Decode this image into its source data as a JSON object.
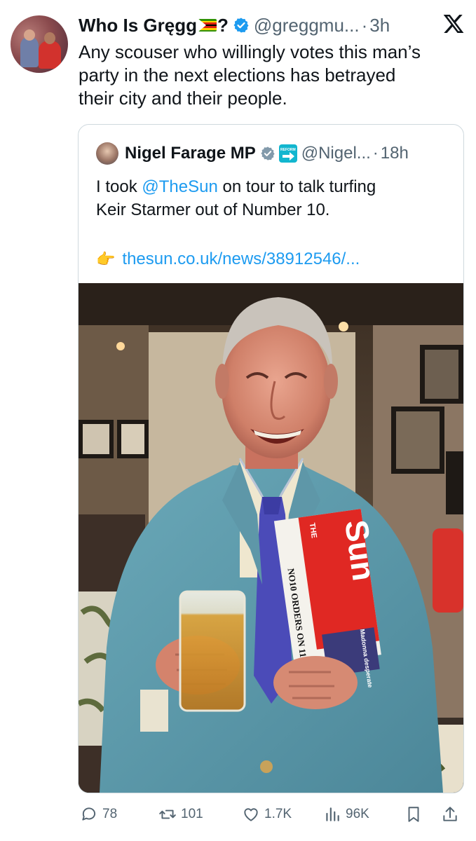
{
  "tweet": {
    "author_name": "Who Is Gręgg",
    "author_name_suffix": "?",
    "handle": "@greggmu...",
    "dot": "·",
    "time": "3h",
    "lines": [
      "Any scouser who willingly votes this man’s",
      "party in the next elections has betrayed",
      "their city and their people."
    ],
    "icons": {
      "avatar": "profile-photo",
      "flag": "zimbabwe-flag-emoji",
      "verified": "verified-badge-icon",
      "brand": "x-logo-icon"
    },
    "colors": {
      "verified": "#1d9bf0",
      "secondary_text": "#536471",
      "link": "#1d9bf0"
    }
  },
  "quote": {
    "author_name": "Nigel Farage MP",
    "badge_text": "REFORM",
    "handle": "@Nigel...",
    "dot": "·",
    "time": "18h",
    "text_prefix": "I took ",
    "mention": "@TheSun",
    "text_suffix": " on tour to talk turfing",
    "line2": "Keir Starmer out of Number 10.",
    "link_emoji": "👉",
    "link": "thesun.co.uk/news/38912546/...",
    "photo": {
      "newspaper_masthead": "Sun",
      "newspaper_label": "THE",
      "newspaper_headline": "NO10 ORDERS ON 11",
      "newspaper_subhead": "Madonna desperate"
    },
    "icons": {
      "avatar": "nigel-farage-avatar",
      "verified": "grey-verified-badge-icon",
      "affiliate": "reform-uk-badge-icon",
      "link_emoji": "pointing-hand-icon"
    },
    "colors": {
      "verified": "#829aab",
      "reform": "#12b6cf"
    }
  },
  "actions": {
    "replies": "78",
    "retweets": "101",
    "likes": "1.7K",
    "views": "96K",
    "icons": [
      "reply-icon",
      "retweet-icon",
      "like-icon",
      "views-icon",
      "bookmark-icon",
      "share-icon"
    ]
  }
}
